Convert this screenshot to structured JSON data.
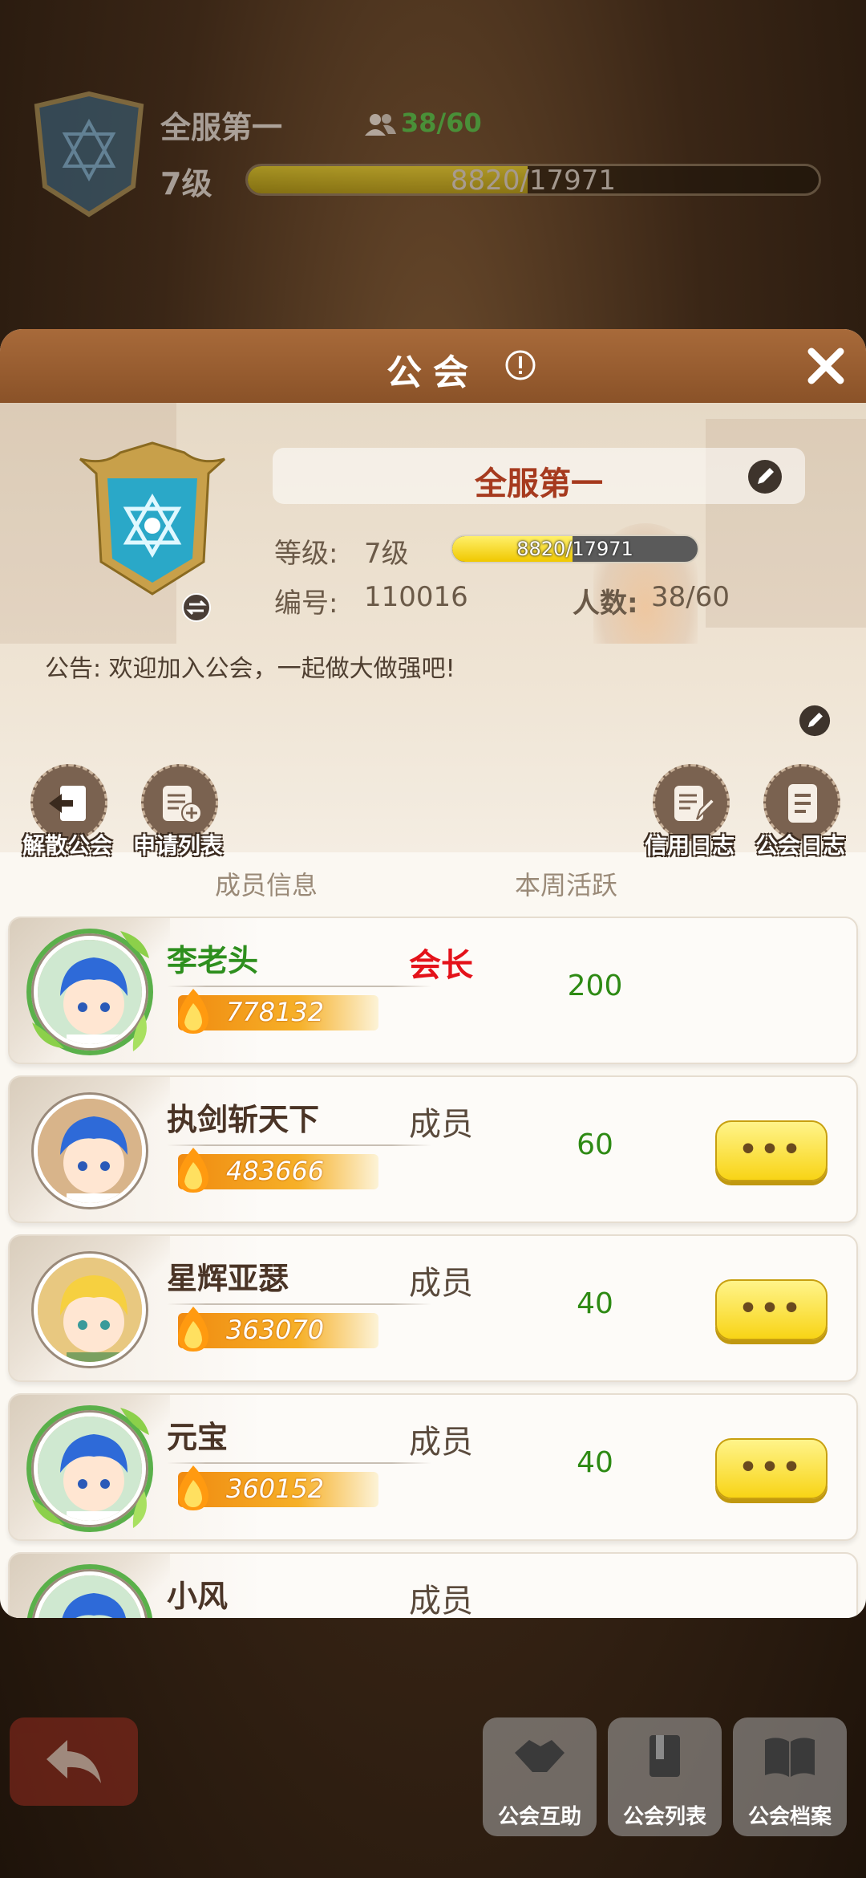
{
  "background": {
    "guild_name": "全服第一",
    "member_count": "38/60",
    "level": "7级",
    "exp_text": "8820/17971",
    "exp_fraction": 0.49,
    "bottom_buttons": [
      "公会互助",
      "公会列表",
      "公会档案"
    ]
  },
  "modal": {
    "title": "公会",
    "guild_name": "全服第一",
    "level_label": "等级:",
    "level_value": "7级",
    "exp_text": "8820/17971",
    "exp_fraction": 0.49,
    "id_label": "编号:",
    "id_value": "110016",
    "members_label": "人数:",
    "members_value": "38/60",
    "notice": "公告: 欢迎加入公会，一起做大做强吧!",
    "actions": {
      "disband": "解散公会",
      "apply_list": "申请列表",
      "credit_log": "信用日志",
      "guild_log": "公会日志"
    },
    "columns": {
      "member_info": "成员信息",
      "weekly_activity": "本周活跃"
    },
    "members": [
      {
        "name": "李老头",
        "power": "778132",
        "role": "会长",
        "activity": "200",
        "leader": true
      },
      {
        "name": "执剑斩天下",
        "power": "483666",
        "role": "成员",
        "activity": "60",
        "leader": false
      },
      {
        "name": "星辉亚瑟",
        "power": "363070",
        "role": "成员",
        "activity": "40",
        "leader": false
      },
      {
        "name": "元宝",
        "power": "360152",
        "role": "成员",
        "activity": "40",
        "leader": false
      },
      {
        "name": "小风",
        "power": "",
        "role": "成员",
        "activity": "",
        "leader": false
      }
    ],
    "more_button_label": "•••"
  },
  "colors": {
    "header_brown": "#8a5228",
    "guild_name_red": "#a63a1e",
    "leader_green": "#2e8f1e",
    "leader_role_red": "#e4121a",
    "activity_green": "#2e8a14",
    "more_button_yellow": "#f8d416"
  }
}
